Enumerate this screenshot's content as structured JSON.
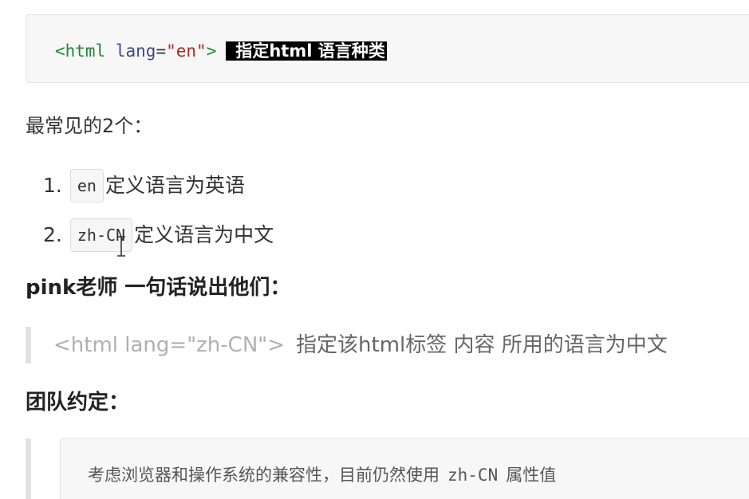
{
  "code_block": {
    "tag_open": "<html",
    "attr_name": "lang",
    "equals": "=",
    "attr_value": "\"en\"",
    "tag_close": ">",
    "highlight": "指定html 语言种类"
  },
  "intro": "最常见的2个：",
  "list": [
    {
      "num": "1.",
      "code": "en",
      "text": "定义语言为英语"
    },
    {
      "num": "2.",
      "code": "zh-CN",
      "text": "定义语言为中文"
    }
  ],
  "heading1": "pink老师 一句话说出他们：",
  "quote1": {
    "tag": "<html lang=\"zh-CN\">",
    "desc": "指定该html标签 内容 所用的语言为中文"
  },
  "heading2": "团队约定：",
  "quote2": {
    "text_before": "考虑浏览器和操作系统的兼容性，目前仍然使用",
    "code": "zh-CN",
    "text_after": "属性值"
  }
}
